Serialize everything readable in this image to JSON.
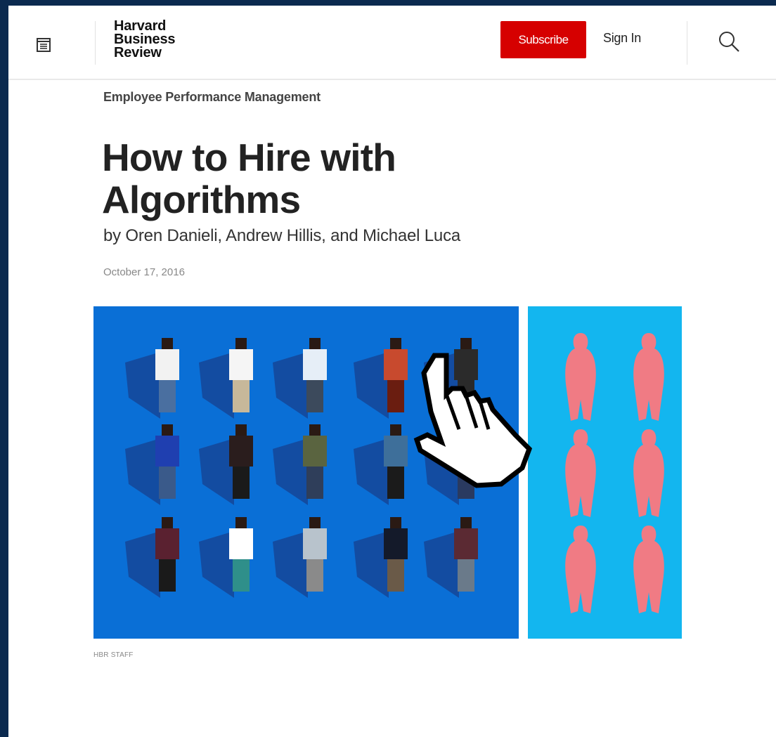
{
  "header": {
    "menu_icon": "menu-icon",
    "logo_lines": [
      "Harvard",
      "Business",
      "Review"
    ],
    "subscribe_label": "Subscribe",
    "signin_label": "Sign In",
    "search_icon": "search-icon"
  },
  "article": {
    "topic": "Employee Performance Management",
    "title": "How to Hire with Algorithms",
    "byline_prefix": "by ",
    "authors": [
      "Oren Danieli",
      "Andrew Hillis",
      "Michael Luca"
    ],
    "date": "October 17, 2016",
    "image_credit": "HBR STAFF"
  },
  "colors": {
    "subscribe_red": "#d60000",
    "hero_blue": "#0a6fd6",
    "hero_cyan": "#13b6ef",
    "silhouette_pink": "#f07b84",
    "outer_frame": "#0b2a4f"
  }
}
